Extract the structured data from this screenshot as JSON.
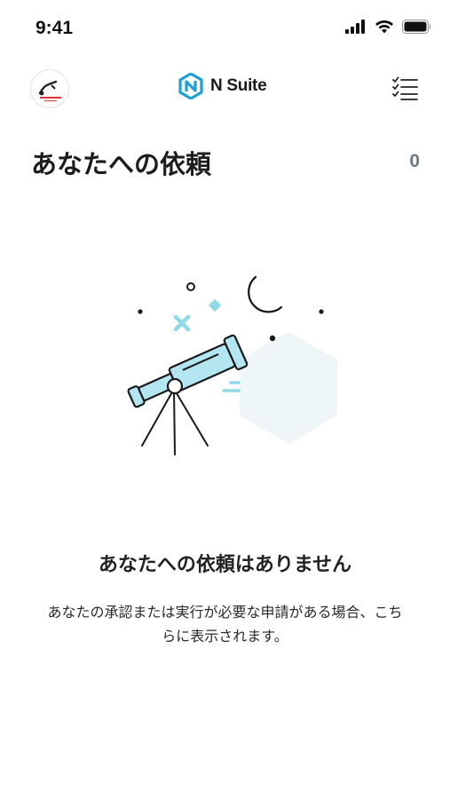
{
  "status_bar": {
    "time": "9:41",
    "icons": [
      "signal-icon",
      "wifi-icon",
      "battery-icon"
    ]
  },
  "header": {
    "avatar": "company-logo",
    "brand_name": "N Suite",
    "brand_icon": "nsuite-logo-icon",
    "menu_icon": "checklist-icon"
  },
  "page": {
    "title": "あなたへの依頼",
    "count": "0"
  },
  "empty_state": {
    "illustration": "telescope-illustration",
    "title": "あなたへの依頼はありません",
    "description": "あなたの承認または実行が必要な申請がある場合、こちらに表示されます。"
  },
  "colors": {
    "accent": "#8fd9e8",
    "accent_light": "#b3e6f1",
    "brand_blue": "#1e9fd6",
    "count_gray": "#6a7a86",
    "hex_bg": "#eef6f7"
  }
}
